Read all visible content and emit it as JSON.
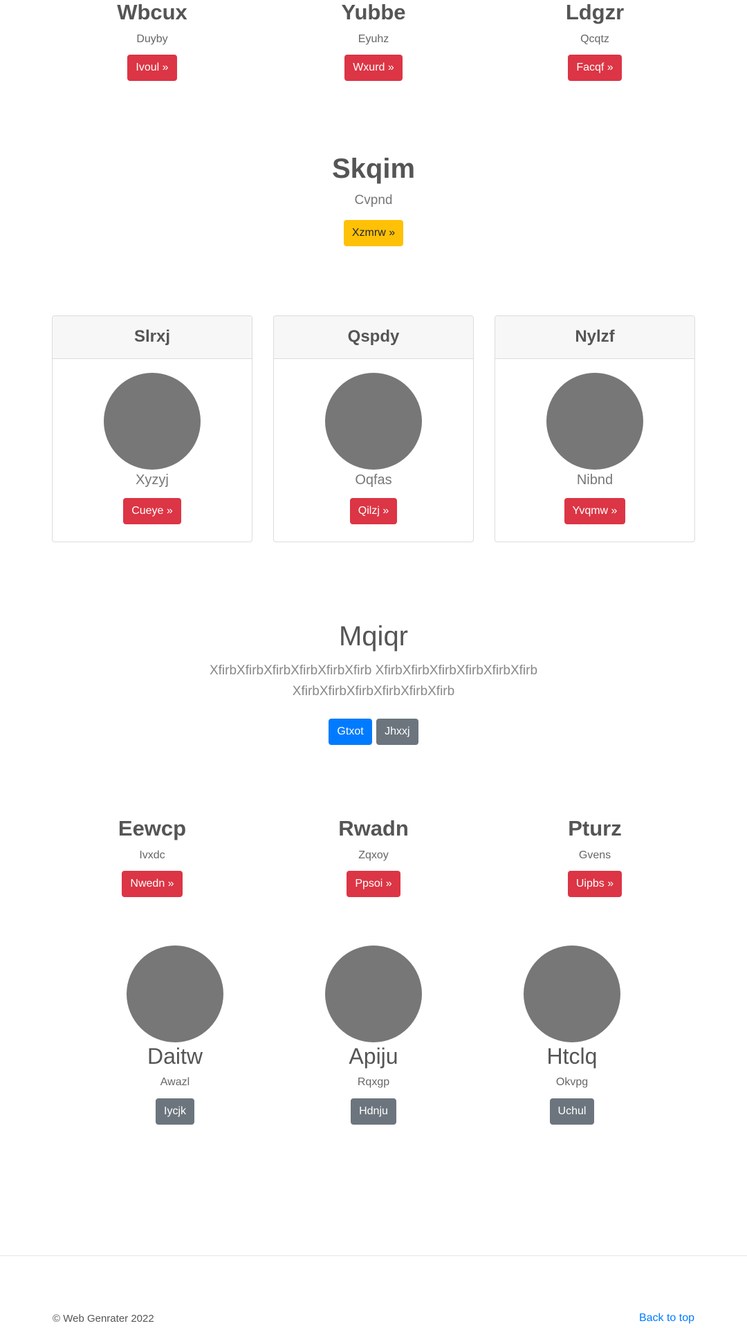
{
  "top_features": [
    {
      "title": "Wbcux",
      "sub": "Duyby",
      "button": "Ivoul »"
    },
    {
      "title": "Yubbe",
      "sub": "Eyuhz",
      "button": "Wxurd »"
    },
    {
      "title": "Ldgzr",
      "sub": "Qcqtz",
      "button": "Facqf »"
    }
  ],
  "hero": {
    "title": "Skqim",
    "sub": "Cvpnd",
    "button": "Xzmrw »"
  },
  "cards": [
    {
      "header": "Slrxj",
      "caption": "Xyzyj",
      "button": "Cueye »"
    },
    {
      "header": "Qspdy",
      "caption": "Oqfas",
      "button": "Qilzj »"
    },
    {
      "header": "Nylzf",
      "caption": "Nibnd",
      "button": "Yvqmw »"
    }
  ],
  "jumbotron": {
    "title": "Mqiqr",
    "line1": "XfirbXfirbXfirbXfirbXfirbXfirb XfirbXfirbXfirbXfirbXfirbXfirb",
    "line2": "XfirbXfirbXfirbXfirbXfirbXfirb",
    "primary": "Gtxot",
    "secondary": "Jhxxj"
  },
  "features2": [
    {
      "title": "Eewcp",
      "sub": "Ivxdc",
      "button": "Nwedn »"
    },
    {
      "title": "Rwadn",
      "sub": "Zqxoy",
      "button": "Ppsoi »"
    },
    {
      "title": "Pturz",
      "sub": "Gvens",
      "button": "Uipbs »"
    }
  ],
  "profiles": [
    {
      "name": "Daitw",
      "sub": "Awazl",
      "button": "Iycjk"
    },
    {
      "name": "Apiju",
      "sub": "Rqxgp",
      "button": "Hdnju"
    },
    {
      "name": "Htclq",
      "sub": "Okvpg",
      "button": "Uchul"
    }
  ],
  "footer": {
    "copyright": "© Web Genrater 2022",
    "back_to_top": "Back to top"
  },
  "colors": {
    "red": "#dc3545",
    "yellow": "#ffc107",
    "blue": "#007bff",
    "gray": "#6c757d",
    "avatar": "#777777"
  }
}
